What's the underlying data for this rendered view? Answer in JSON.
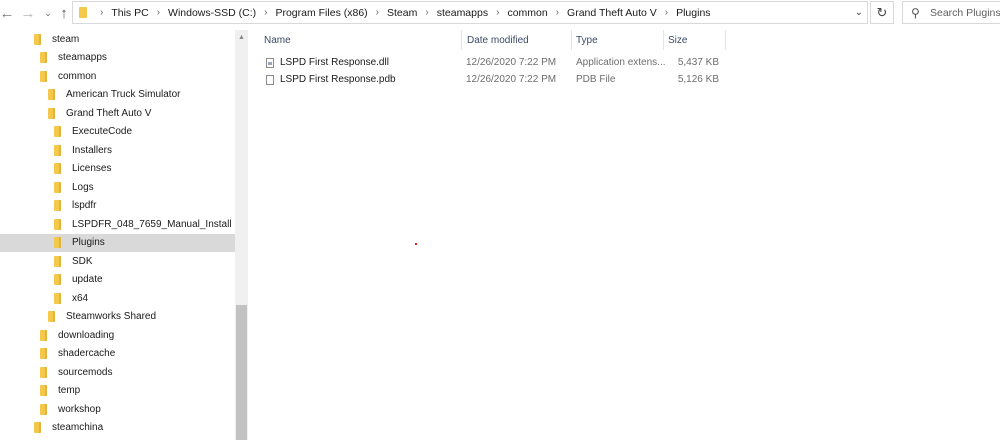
{
  "nav": {
    "back_icon": "back-arrow-icon",
    "forward_icon": "forward-arrow-icon",
    "recent_icon": "chevron-down-icon",
    "up_icon": "up-arrow-icon"
  },
  "address": {
    "crumbs": [
      "This PC",
      "Windows-SSD (C:)",
      "Program Files (x86)",
      "Steam",
      "steamapps",
      "common",
      "Grand Theft Auto V",
      "Plugins"
    ]
  },
  "search": {
    "placeholder": "Search Plugins"
  },
  "tree": {
    "items": [
      {
        "label": "steam",
        "level": 0
      },
      {
        "label": "steamapps",
        "level": 1
      },
      {
        "label": "common",
        "level": 2
      },
      {
        "label": "American Truck Simulator",
        "level": 3
      },
      {
        "label": "Grand Theft Auto V",
        "level": 3
      },
      {
        "label": "ExecuteCode",
        "level": 4
      },
      {
        "label": "Installers",
        "level": 4
      },
      {
        "label": "Licenses",
        "level": 4
      },
      {
        "label": "Logs",
        "level": 4
      },
      {
        "label": "lspdfr",
        "level": 4
      },
      {
        "label": "LSPDFR_048_7659_Manual_Install",
        "level": 4
      },
      {
        "label": "Plugins",
        "level": 4,
        "selected": true
      },
      {
        "label": "SDK",
        "level": 4
      },
      {
        "label": "update",
        "level": 4
      },
      {
        "label": "x64",
        "level": 4
      },
      {
        "label": "Steamworks Shared",
        "level": 3
      },
      {
        "label": "downloading",
        "level": 2
      },
      {
        "label": "shadercache",
        "level": 2
      },
      {
        "label": "sourcemods",
        "level": 2
      },
      {
        "label": "temp",
        "level": 2
      },
      {
        "label": "workshop",
        "level": 2
      },
      {
        "label": "steamchina",
        "level": 0
      }
    ]
  },
  "columns": {
    "name": "Name",
    "date": "Date modified",
    "type": "Type",
    "size": "Size"
  },
  "files": [
    {
      "name": "LSPD First Response.dll",
      "date": "12/26/2020 7:22 PM",
      "type": "Application extens...",
      "size": "5,437 KB",
      "icon": "dll-file-icon"
    },
    {
      "name": "LSPD First Response.pdb",
      "date": "12/26/2020 7:22 PM",
      "type": "PDB File",
      "size": "5,126 KB",
      "icon": "document-file-icon"
    }
  ],
  "colors": {
    "folder": "#f4c84a",
    "selection": "#d9d9d9",
    "header_text": "#3b4a66"
  }
}
